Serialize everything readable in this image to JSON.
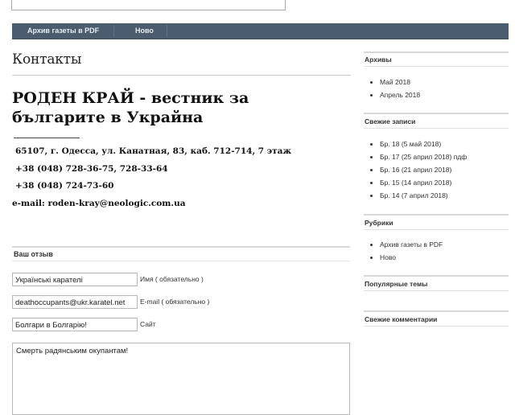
{
  "nav": {
    "items": [
      "Архив газеты в PDF",
      "Ново"
    ]
  },
  "main": {
    "page_title": "Контакты",
    "heading": "РОДЕН КРАЙ - вестник за българите в Украйна",
    "address": "65107, г. Одесса, ул. Канатная, 83, каб. 712-714, 7 этаж",
    "phone1": "+38 (048) 728-36-75, 728-33-64",
    "phone2": "+38 (048) 724-73-60",
    "email": "e-mail: roden-kray@neologic.com.ua"
  },
  "form": {
    "section_title": "Ваш отзыв",
    "name_value": "Українські карателі",
    "name_label": "Имя ( обязательно )",
    "email_value": "deathoccupants@ukr.karatel.net",
    "email_label": "E-mail ( обязательно )",
    "site_value": "Болгари в Болгарію!",
    "site_label": "Сайт",
    "comment_value": "Смерть радянським окупантам!"
  },
  "sidebar": {
    "archives": {
      "title": "Архивы",
      "items": [
        "Май 2018",
        "Апрель 2018"
      ]
    },
    "recent": {
      "title": "Свежие записи",
      "items": [
        "Бр. 18 (5 май 2018)",
        "Бр. 17 (25 април 2018) пдф",
        "Бр. 16 (21 април 2018)",
        "Бр. 15 (14 април 2018)",
        "Бр. 14 (7 април 2018)"
      ]
    },
    "categories": {
      "title": "Рубрики",
      "items": [
        "Архив газеты в PDF",
        "Ново"
      ]
    },
    "popular": {
      "title": "Популярные темы"
    },
    "comments": {
      "title": "Свежие комментарии"
    }
  }
}
